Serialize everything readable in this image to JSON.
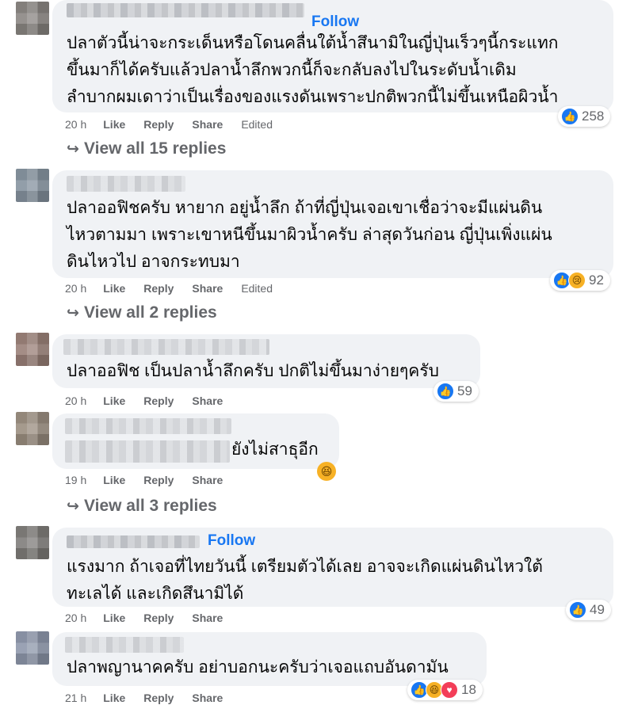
{
  "comments": [
    {
      "follow": "Follow",
      "text": "ปลาตัวนี้น่าจะกระเด็นหรือโดนคลื่นใต้น้ำสึนามิในญี่ปุ่นเร็วๆนี้กระแทก\nขึ้นมาก็ได้ครับแล้วปลาน้ำลึกพวกนี้ก็จะกลับลงไปในระดับน้ำเดิม\nลำบากผมเดาว่าเป็นเรื่องของแรงดันเพราะปกติพวกนี้ไม่ขึ้นเหนือผิวน้ำ",
      "time": "20 h",
      "like": "Like",
      "reply": "Reply",
      "share": "Share",
      "edited": "Edited",
      "reaction_count": "258",
      "view_replies": "View all 15 replies"
    },
    {
      "text": "ปลาออฟิชครับ หายาก อยู่น้ำลึก ถ้าที่ญี่ปุ่นเจอเขาเชื่อว่าจะมีแผ่นดิน\nไหวตามมา เพราะเขาหนีขึ้นมาผิวน้ำครับ ล่าสุดวันก่อน ญี่ปุ่นเพิ่งแผ่น\nดินไหวไป อาจกระทบมา",
      "time": "20 h",
      "like": "Like",
      "reply": "Reply",
      "share": "Share",
      "edited": "Edited",
      "reaction_count": "92",
      "view_replies": "View all 2 replies"
    },
    {
      "text": "ปลาออฟิช เป็นปลาน้ำลึกครับ ปกติไม่ขึ้นมาง่ายๆครับ",
      "time": "20 h",
      "like": "Like",
      "reply": "Reply",
      "share": "Share",
      "reaction_count": "59"
    },
    {
      "text": "ยังไม่สาธุอีก",
      "time": "19 h",
      "like": "Like",
      "reply": "Reply",
      "share": "Share",
      "view_replies": "View all 3 replies"
    },
    {
      "follow": "Follow",
      "text": "แรงมาก ถ้าเจอที่ไทยวันนี้ เตรียมตัวได้เลย อาจจะเกิดแผ่นดินไหวใต้\nทะเลได้ และเกิดสึนามิได้",
      "time": "20 h",
      "like": "Like",
      "reply": "Reply",
      "share": "Share",
      "reaction_count": "49"
    },
    {
      "text": "ปลาพญานาคครับ อย่าบอกนะครับว่าเจอแถบอันดามัน",
      "time": "21 h",
      "like": "Like",
      "reply": "Reply",
      "share": "Share",
      "reaction_count": "18"
    }
  ],
  "icons": {
    "like": "like-icon",
    "sad": "sad-icon",
    "haha": "haha-icon",
    "love": "love-icon",
    "reply_arrow": "reply-arrow-icon"
  },
  "colors": {
    "accent": "#1877f2",
    "bubble": "#f0f2f5",
    "meta": "#65676b"
  }
}
